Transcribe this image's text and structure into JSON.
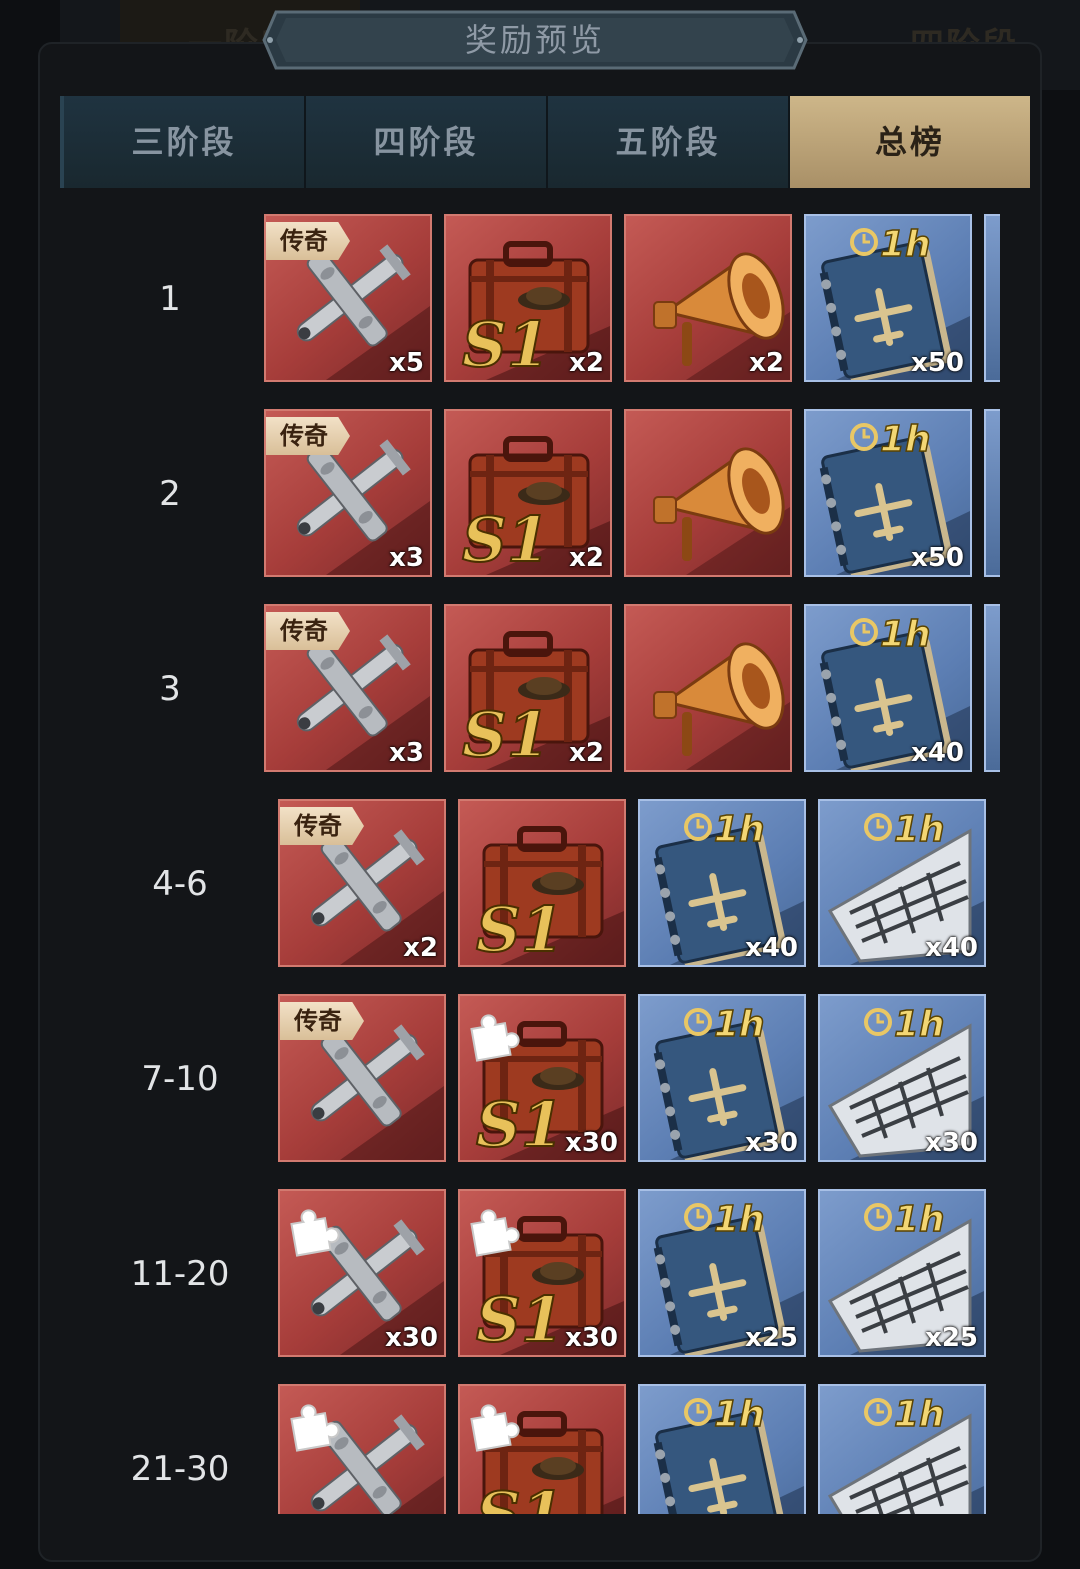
{
  "header": {
    "title": "奖励预览",
    "background_tabs": [
      "一阶段",
      "四阶段"
    ]
  },
  "tabs": [
    {
      "label": "三阶段",
      "active": false
    },
    {
      "label": "四阶段",
      "active": false
    },
    {
      "label": "五阶段",
      "active": false
    },
    {
      "label": "总榜",
      "active": true
    }
  ],
  "legend_tag": "传奇",
  "timer_label": "1h",
  "rows": [
    {
      "rank": "1",
      "items": [
        {
          "kind": "plane",
          "tag": true,
          "qty": "x5"
        },
        {
          "kind": "suitcase",
          "qty": "x2"
        },
        {
          "kind": "horn",
          "qty": "x2"
        },
        {
          "kind": "manual",
          "qty": "x50"
        }
      ],
      "more": true
    },
    {
      "rank": "2",
      "items": [
        {
          "kind": "plane",
          "tag": true,
          "qty": "x3"
        },
        {
          "kind": "suitcase",
          "qty": "x2"
        },
        {
          "kind": "horn",
          "qty": ""
        },
        {
          "kind": "manual",
          "qty": "x50"
        }
      ],
      "more": true
    },
    {
      "rank": "3",
      "items": [
        {
          "kind": "plane",
          "tag": true,
          "qty": "x3"
        },
        {
          "kind": "suitcase",
          "qty": "x2"
        },
        {
          "kind": "horn",
          "qty": ""
        },
        {
          "kind": "manual",
          "qty": "x40"
        }
      ],
      "more": true
    },
    {
      "rank": "4-6",
      "items": [
        {
          "kind": "plane",
          "tag": true,
          "qty": "x2"
        },
        {
          "kind": "suitcase",
          "qty": ""
        },
        {
          "kind": "manual",
          "qty": "x40"
        },
        {
          "kind": "wing",
          "qty": "x40"
        }
      ],
      "more": false
    },
    {
      "rank": "7-10",
      "items": [
        {
          "kind": "plane",
          "tag": true,
          "qty": ""
        },
        {
          "kind": "suitcase-frag",
          "qty": "x30"
        },
        {
          "kind": "manual",
          "qty": "x30"
        },
        {
          "kind": "wing",
          "qty": "x30"
        }
      ],
      "more": false
    },
    {
      "rank": "11-20",
      "items": [
        {
          "kind": "plane-frag",
          "qty": "x30"
        },
        {
          "kind": "suitcase-frag",
          "qty": "x30"
        },
        {
          "kind": "manual",
          "qty": "x25"
        },
        {
          "kind": "wing",
          "qty": "x25"
        }
      ],
      "more": false
    },
    {
      "rank": "21-30",
      "items": [
        {
          "kind": "plane-frag",
          "qty": ""
        },
        {
          "kind": "suitcase-frag",
          "qty": ""
        },
        {
          "kind": "manual",
          "qty": ""
        },
        {
          "kind": "wing",
          "qty": ""
        }
      ],
      "more": false
    }
  ]
}
